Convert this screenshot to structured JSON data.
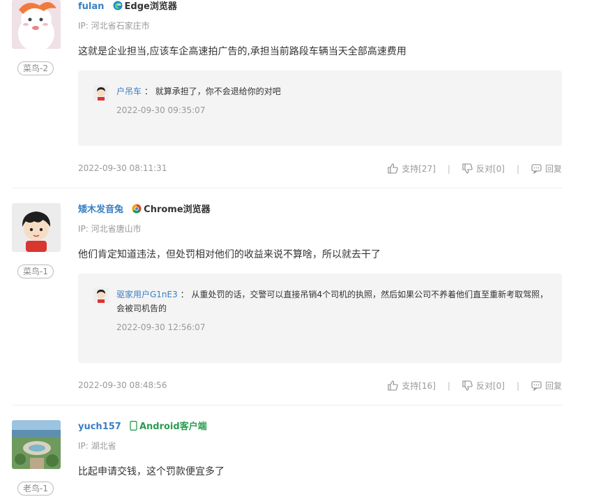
{
  "comments": [
    {
      "username": "fulan",
      "client": "Edge浏览器",
      "client_icon": "edge-icon",
      "ip": "IP: 河北省石家庄市",
      "badge": "菜鸟-2",
      "text": "这就是企业担当,应该车企高速拍广告的,承担当前路段车辆当天全部高速费用",
      "reply": {
        "user": "户吊车",
        "separator": "：",
        "text": "就算承担了，你不会退给你的对吧",
        "time": "2022-09-30 09:35:07"
      },
      "time": "2022-09-30 08:11:31",
      "support": "支持[27]",
      "oppose": "反对[0]",
      "reply_label": "回复"
    },
    {
      "username": "矮木发音兔",
      "client": "Chrome浏览器",
      "client_icon": "chrome-icon",
      "ip": "IP: 河北省唐山市",
      "badge": "菜鸟-1",
      "text": "他们肯定知道违法，但处罚相对他们的收益来说不算啥，所以就去干了",
      "reply": {
        "user": "驱家用户G1nE3",
        "separator": "：",
        "text": "从重处罚的话，交警可以直接吊销4个司机的执照，然后如果公司不养着他们直至重新考取驾照，会被司机告的",
        "time": "2022-09-30 12:56:07"
      },
      "time": "2022-09-30 08:48:56",
      "support": "支持[16]",
      "oppose": "反对[0]",
      "reply_label": "回复"
    },
    {
      "username": "yuch157",
      "client": "Android客户端",
      "client_icon": "phone-icon",
      "ip": "IP: 湖北省",
      "badge": "老鸟-1",
      "text": "比起申请交钱，这个罚款便宜多了"
    }
  ],
  "colors": {
    "username": "#3a7fc4",
    "android": "#2a9c52",
    "reply_bg": "#f4f4f4",
    "muted": "#999999"
  }
}
